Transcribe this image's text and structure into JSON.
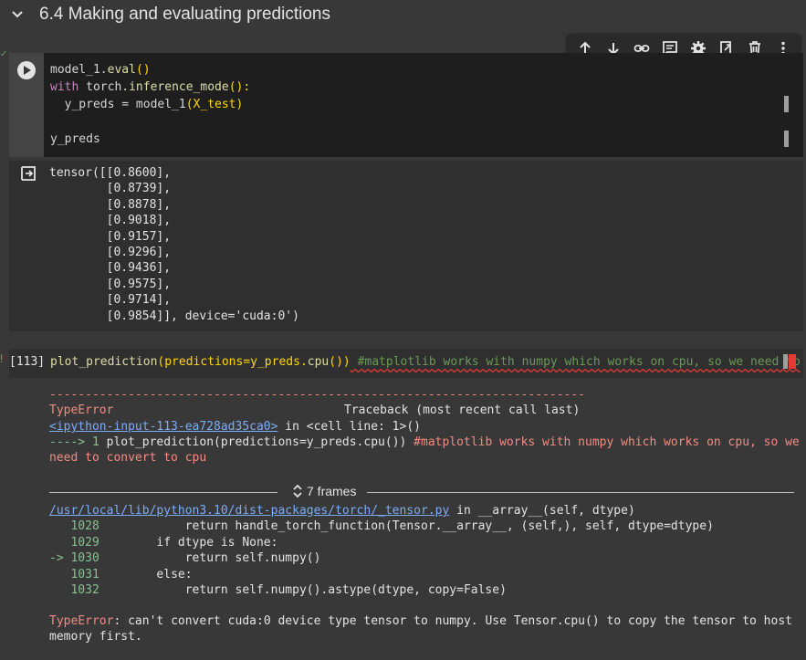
{
  "section": {
    "title": "6.4 Making and evaluating predictions"
  },
  "toolbar": {
    "icons": [
      "arrow-up-icon",
      "arrow-down-icon",
      "link-icon",
      "comment-icon",
      "gear-icon",
      "mirror-icon",
      "trash-icon",
      "more-vert-icon"
    ]
  },
  "cell1": {
    "lines": [
      [
        "model_1.",
        "eval",
        "()"
      ],
      [
        "with",
        " torch.",
        "inference_mode",
        "():"
      ],
      [
        "  y_preds = ",
        "model_1",
        "(X_test)"
      ],
      [
        ""
      ],
      [
        "y_preds"
      ]
    ]
  },
  "output1": {
    "lines": [
      "tensor([[0.8600],",
      "        [0.8739],",
      "        [0.8878],",
      "        [0.9018],",
      "        [0.9157],",
      "        [0.9296],",
      "        [0.9436],",
      "        [0.9575],",
      "        [0.9714],",
      "        [0.9854]], device='cuda:0')"
    ]
  },
  "cell2": {
    "exec_count": "[113]",
    "code_a": "plot_prediction",
    "code_b": "(predictions=y_preds.",
    "code_c": "cpu",
    "code_d": "())",
    "code_comment": " #matplotlib works with numpy which works on cpu, so we need to"
  },
  "traceback": {
    "dashes": "---------------------------------------------------------------------------",
    "error_type": "TypeError",
    "traceback_label": "Traceback (most recent call last)",
    "input_link": "<ipython-input-113-ea728ad35ca0>",
    "input_loc": " in <cell line: 1>()",
    "arrow": "----> 1 ",
    "line1_code": "plot_prediction(predictions=y_preds.cpu()) ",
    "line1_comment": "#matplotlib works with numpy which works on cpu, so we",
    "line1_comment2": "need to convert to cpu",
    "frames_label": "7 frames",
    "file_link": "/usr/local/lib/python3.10/dist-packages/torch/_tensor.py",
    "file_loc": " in __array__(self, dtype)",
    "src": [
      {
        "num": "   1028",
        "code": "            return handle_torch_function(Tensor.__array__, (self,), self, dtype=dtype)"
      },
      {
        "num": "   1029",
        "code": "        if dtype is None:"
      },
      {
        "num": "-> 1030",
        "code": "            return self.numpy()"
      },
      {
        "num": "   1031",
        "code": "        else:"
      },
      {
        "num": "   1032",
        "code": "            return self.numpy().astype(dtype, copy=False)"
      }
    ],
    "final_type": "TypeError",
    "final_msg": ": can't convert cuda:0 device type tensor to numpy. Use Tensor.cpu() to copy the tensor to host",
    "final_msg2": "memory first."
  }
}
